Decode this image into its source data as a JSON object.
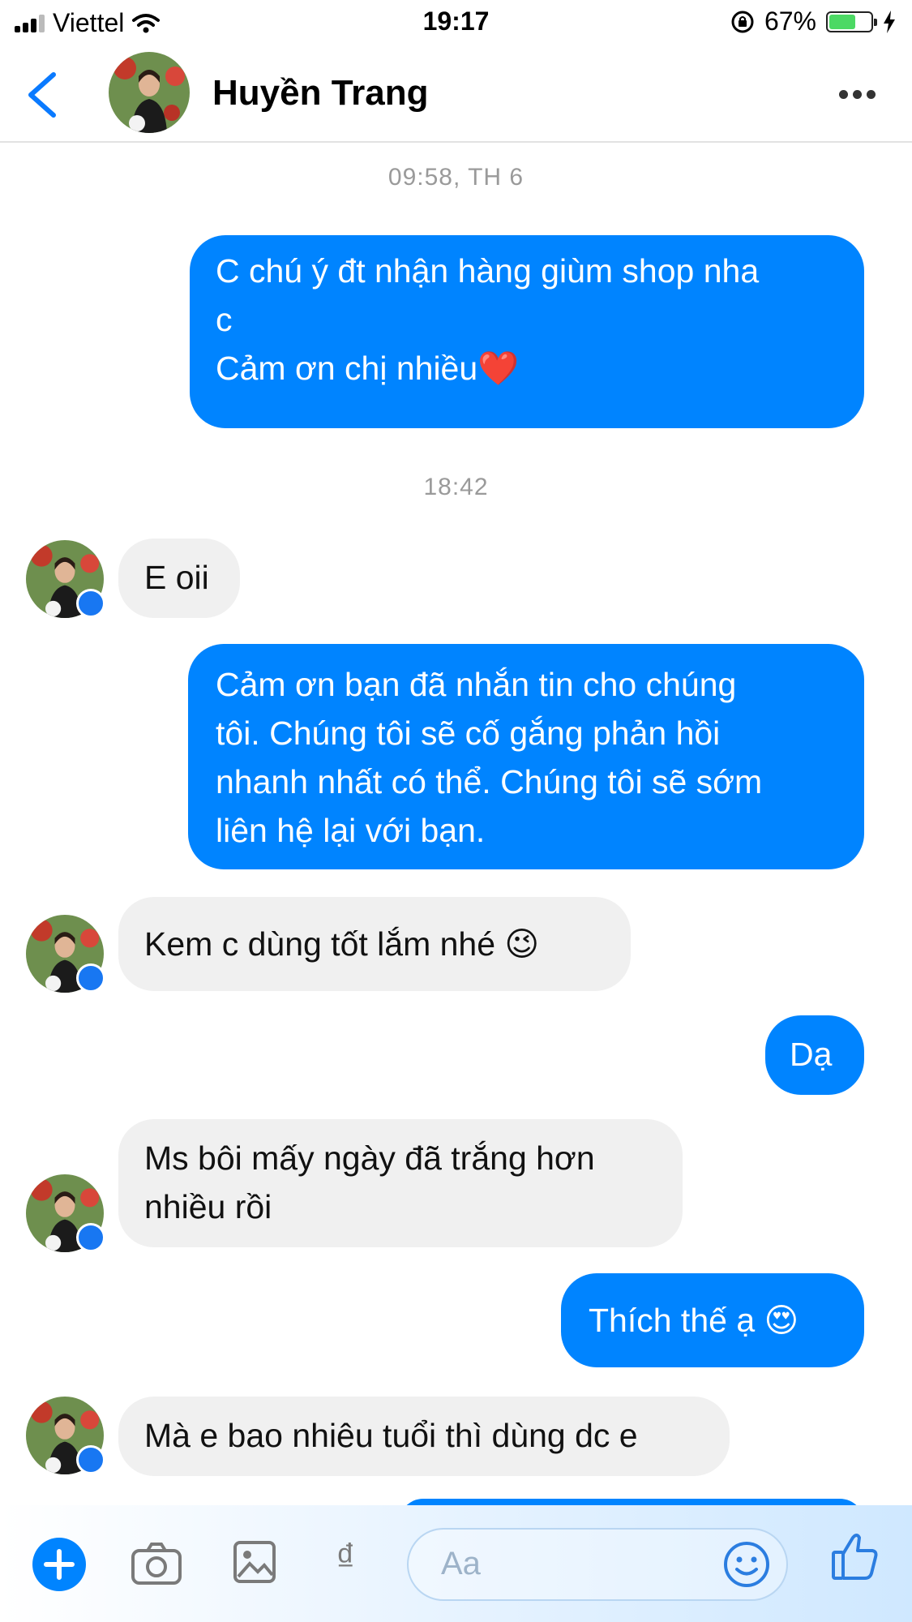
{
  "status_bar": {
    "carrier": "Viettel",
    "time": "19:17",
    "battery": "67%",
    "battery_level": 0.67
  },
  "header": {
    "contact_name": "Huyền Trang",
    "back_icon": "chevron-left-icon",
    "more_icon": "more-horizontal-icon"
  },
  "conversation": {
    "timestamp_1": "09:58, TH 6",
    "msg_1": "C chú ý đt nhận hàng giùm shop nha\nc\nCảm ơn chị nhiều❤️",
    "timestamp_2": "18:42",
    "msg_2": "E oii",
    "msg_3": "Cảm ơn bạn đã nhắn tin cho chúng\ntôi. Chúng tôi sẽ cố gắng phản hồi\nnhanh nhất có thể. Chúng tôi sẽ sớm\nliên hệ lại với bạn.",
    "msg_4": "Kem c dùng tốt lắm nhé 😉",
    "msg_5": "Dạ",
    "msg_6": "Ms bôi mấy ngày đã trắng hơn\nnhiều rồi",
    "msg_7": "Thích thế ạ 😍",
    "msg_8": "Mà e bao nhiêu tuổi thì dùng dc e"
  },
  "composer": {
    "placeholder": "Aa",
    "currency_symbol": "₫",
    "icons": [
      "plus-icon",
      "camera-icon",
      "image-icon",
      "dong-icon",
      "emoji-icon",
      "like-icon"
    ]
  },
  "colors": {
    "outgoing_bubble": "#0084ff",
    "incoming_bubble": "#f0f0f0",
    "accent": "#0084ff"
  }
}
